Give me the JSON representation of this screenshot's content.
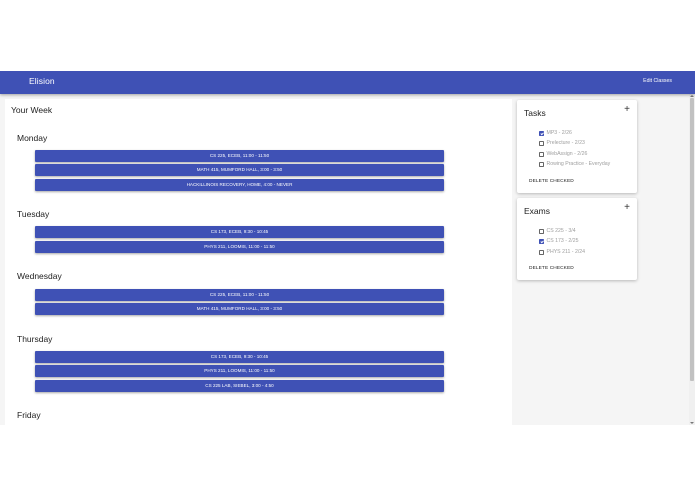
{
  "app": {
    "title": "Elision",
    "edit_classes": "Edit Classes"
  },
  "colors": {
    "primary": "#3f51b5",
    "background": "#f5f5f5",
    "muted_text": "#9e9e9e"
  },
  "week": {
    "title": "Your Week",
    "days": [
      {
        "name": "Monday",
        "classes": [
          "CS 225, ECEB, 11:00 - 11:50",
          "MATH 415, MUMFORD HALL, 3:00 - 3:50",
          "HACKILLINOIS RECOVERY, HOME, 4:00 - NEVER"
        ]
      },
      {
        "name": "Tuesday",
        "classes": [
          "CS 173, ECEB, 9:30 - 10:45",
          "PHYS 211, LOOMIS, 11:00 - 11:50"
        ]
      },
      {
        "name": "Wednesday",
        "classes": [
          "CS 225, ECEB, 11:00 - 11:50",
          "MATH 415, MUMFORD HALL, 3:00 - 3:50"
        ]
      },
      {
        "name": "Thursday",
        "classes": [
          "CS 173, ECEB, 9:30 - 10:45",
          "PHYS 211, LOOMIS, 11:00 - 11:50",
          "CS 225 LAB, SIEBEL, 3:00 - 4:50"
        ]
      },
      {
        "name": "Friday",
        "classes": []
      }
    ]
  },
  "tasks": {
    "title": "Tasks",
    "add_icon": "plus-icon",
    "items": [
      {
        "label": "MP3 - 2/26",
        "checked": true
      },
      {
        "label": "Prelecture - 2/23",
        "checked": false
      },
      {
        "label": "WebAssign - 2/26",
        "checked": false
      },
      {
        "label": "Rowing Practice - Everyday",
        "checked": false
      }
    ],
    "delete_label": "DELETE CHECKED"
  },
  "exams": {
    "title": "Exams",
    "add_icon": "plus-icon",
    "items": [
      {
        "label": "CS 225 - 3/4",
        "checked": false
      },
      {
        "label": "CS 173 - 2/25",
        "checked": true
      },
      {
        "label": "PHYS 211 - 2/24",
        "checked": false
      }
    ],
    "delete_label": "DELETE CHECKED"
  }
}
